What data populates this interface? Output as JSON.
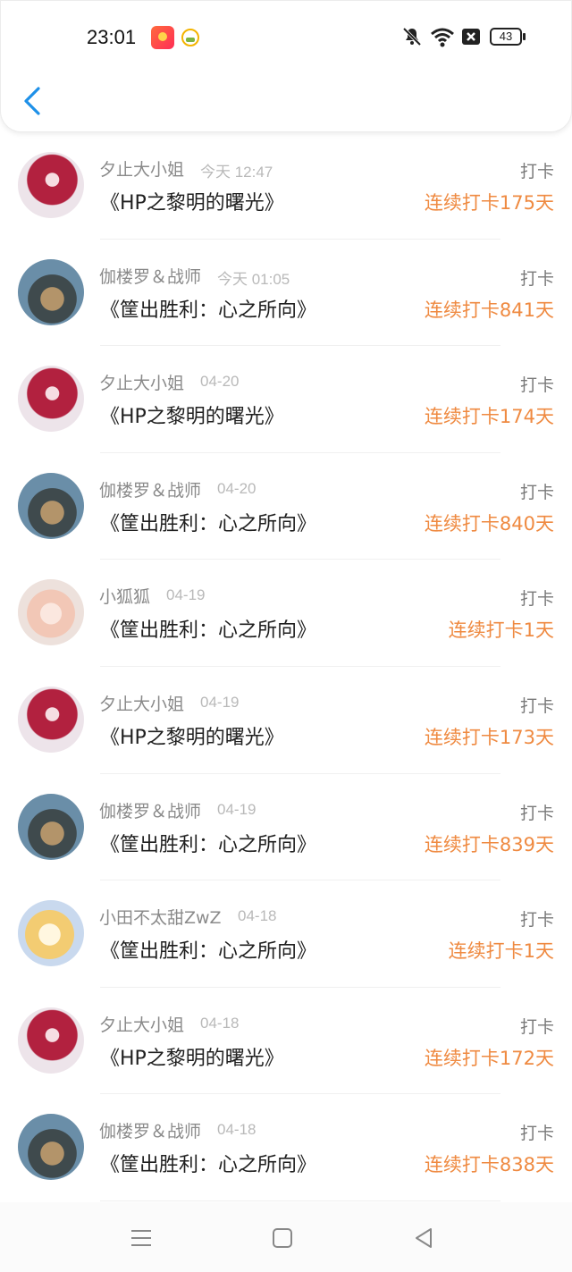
{
  "status_bar": {
    "time": "23:01",
    "battery": "43",
    "icons": [
      "app-icon-orange",
      "app-icon-smiley",
      "mute-icon",
      "wifi-icon",
      "sim-x-icon",
      "battery-icon"
    ]
  },
  "header": {
    "back_icon": "chevron-left-icon"
  },
  "colors": {
    "accent_blue": "#1e90e8",
    "streak_orange": "#ef8a41",
    "username_gray": "#8a8a8a"
  },
  "feed": [
    {
      "avatar": "red",
      "user": "夕止大小姐",
      "time": "今天 12:47",
      "book": "《HP之黎明的曙光》",
      "action": "打卡",
      "streak": "连续打卡175天"
    },
    {
      "avatar": "warrior",
      "user": "伽楼罗＆战师",
      "time": "今天 01:05",
      "book": "《筐出胜利：心之所向》",
      "action": "打卡",
      "streak": "连续打卡841天"
    },
    {
      "avatar": "red",
      "user": "夕止大小姐",
      "time": "04-20",
      "book": "《HP之黎明的曙光》",
      "action": "打卡",
      "streak": "连续打卡174天"
    },
    {
      "avatar": "warrior",
      "user": "伽楼罗＆战师",
      "time": "04-20",
      "book": "《筐出胜利：心之所向》",
      "action": "打卡",
      "streak": "连续打卡840天"
    },
    {
      "avatar": "fox",
      "user": "小狐狐",
      "time": "04-19",
      "book": "《筐出胜利：心之所向》",
      "action": "打卡",
      "streak": "连续打卡1天"
    },
    {
      "avatar": "red",
      "user": "夕止大小姐",
      "time": "04-19",
      "book": "《HP之黎明的曙光》",
      "action": "打卡",
      "streak": "连续打卡173天"
    },
    {
      "avatar": "warrior",
      "user": "伽楼罗＆战师",
      "time": "04-19",
      "book": "《筐出胜利：心之所向》",
      "action": "打卡",
      "streak": "连续打卡839天"
    },
    {
      "avatar": "blond",
      "user": "小田不太甜ZwZ",
      "time": "04-18",
      "book": "《筐出胜利：心之所向》",
      "action": "打卡",
      "streak": "连续打卡1天"
    },
    {
      "avatar": "red",
      "user": "夕止大小姐",
      "time": "04-18",
      "book": "《HP之黎明的曙光》",
      "action": "打卡",
      "streak": "连续打卡172天"
    },
    {
      "avatar": "warrior",
      "user": "伽楼罗＆战师",
      "time": "04-18",
      "book": "《筐出胜利：心之所向》",
      "action": "打卡",
      "streak": "连续打卡838天"
    }
  ],
  "nav_bar": {
    "icons": [
      "menu-icon",
      "home-square-icon",
      "back-triangle-icon"
    ]
  }
}
